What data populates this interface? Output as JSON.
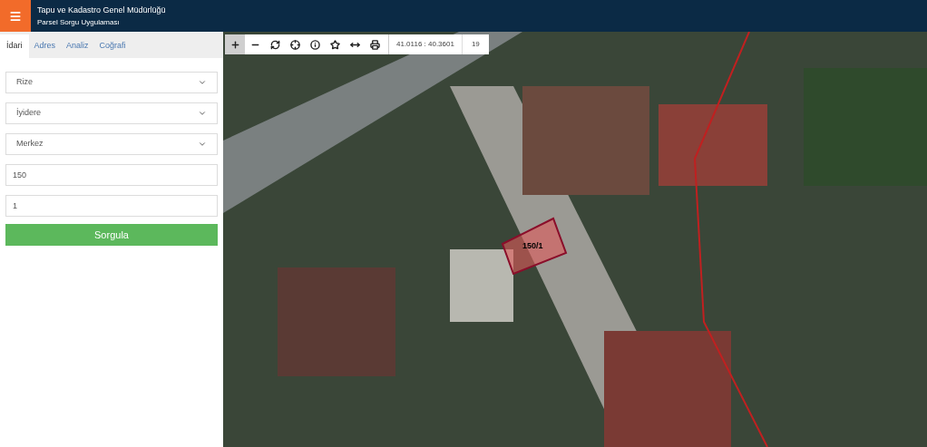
{
  "header": {
    "title": "Tapu ve Kadastro Genel Müdürlüğü",
    "subtitle": "Parsel Sorgu Uygulaması"
  },
  "tabs": [
    {
      "label": "İdari",
      "selected": true
    },
    {
      "label": "Adres",
      "selected": false
    },
    {
      "label": "Analiz",
      "selected": false
    },
    {
      "label": "Coğrafi",
      "selected": false
    }
  ],
  "form": {
    "fields": [
      {
        "kind": "select",
        "value": "Rize"
      },
      {
        "kind": "select",
        "value": "İyidere"
      },
      {
        "kind": "select",
        "value": "Merkez"
      },
      {
        "kind": "input",
        "value": "150"
      },
      {
        "kind": "input",
        "value": "1"
      }
    ],
    "submit": "Sorgula"
  },
  "toolbar": {
    "tools": [
      {
        "kind": "zoom-in",
        "active": true
      },
      {
        "kind": "zoom-out",
        "active": false
      },
      {
        "kind": "refresh",
        "active": false
      },
      {
        "kind": "locate",
        "active": false
      },
      {
        "kind": "info",
        "active": false
      },
      {
        "kind": "favorite",
        "active": false
      },
      {
        "kind": "measure",
        "active": false
      },
      {
        "kind": "print",
        "active": false
      }
    ],
    "coordinates": "41.0116 : 40.3601",
    "zoom": "19"
  },
  "map": {
    "parcel_label": "150/1"
  }
}
